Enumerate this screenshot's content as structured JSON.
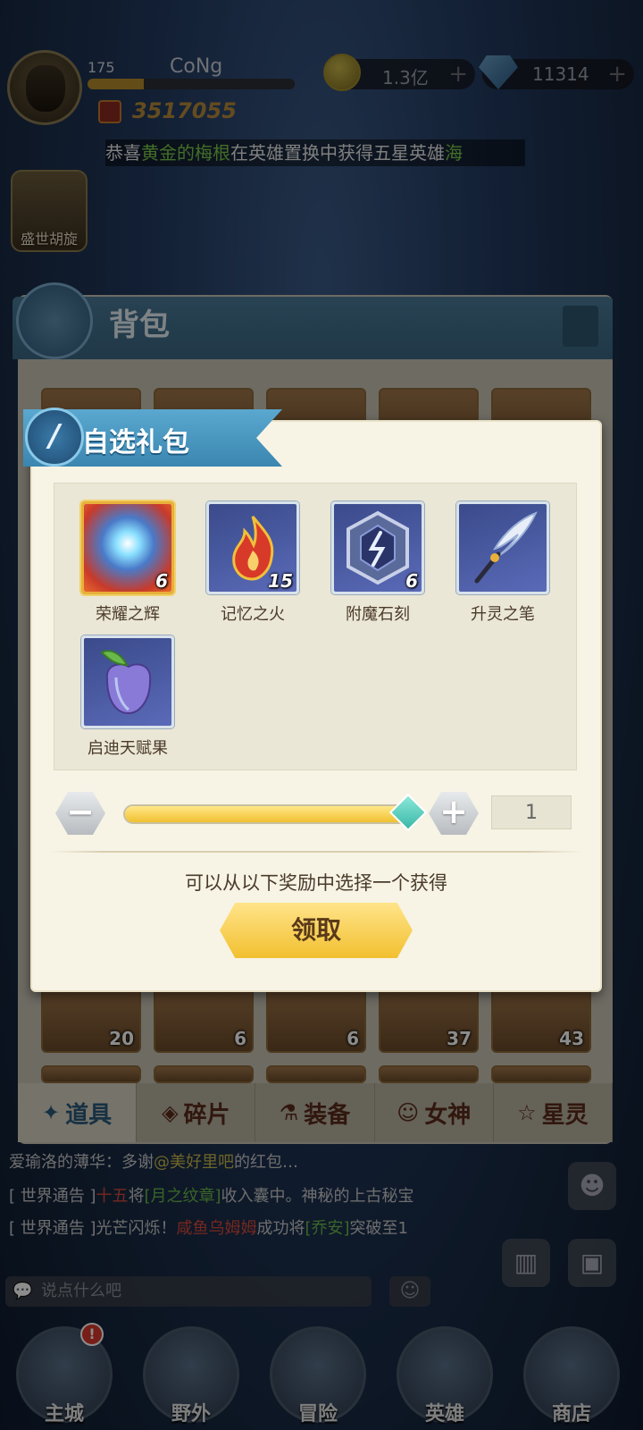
{
  "hud": {
    "level": "175",
    "player_name": "CoNg",
    "exp_fraction": 0.27,
    "power": "3517055",
    "gold": "1.3亿",
    "gems": "11314",
    "plus": "+"
  },
  "marquee": {
    "prefix": "恭喜",
    "player": "黄金的梅根",
    "middle": "在英雄置换中获得五星英雄",
    "suffix": "海"
  },
  "event": {
    "label": "盛世胡旋"
  },
  "bag": {
    "title": "背包",
    "row_top_counts": [
      "",
      "",
      "",
      "",
      ""
    ],
    "row_bottom_counts": [
      "20",
      "6",
      "6",
      "37",
      "43"
    ],
    "tabs": [
      {
        "label": "道具",
        "icon": "✦"
      },
      {
        "label": "碎片",
        "icon": "◈"
      },
      {
        "label": "装备",
        "icon": "⚗"
      },
      {
        "label": "女神",
        "icon": "☺"
      },
      {
        "label": "星灵",
        "icon": "☆"
      }
    ]
  },
  "dialog": {
    "title": "自选礼包",
    "emblem": "/",
    "items": [
      {
        "name": "荣耀之辉",
        "count": "6"
      },
      {
        "name": "记忆之火",
        "count": "15"
      },
      {
        "name": "附魔石刻",
        "count": "6"
      },
      {
        "name": "升灵之笔",
        "count": ""
      },
      {
        "name": "启迪天赋果",
        "count": ""
      }
    ],
    "quantity": "1",
    "slider_fraction": 1.0,
    "minus": "−",
    "plus": "+",
    "hint": "可以从以下奖励中选择一个获得",
    "claim": "领取"
  },
  "chat": {
    "line1": {
      "user": "爱瑜洛的薄华",
      "text": "：多谢",
      "mention": "@美好里吧",
      "tail": "的红包…"
    },
    "line2": {
      "tag": "[ 世界通告 ]",
      "player": "十五",
      "a": "将",
      "item": "[月之纹章]",
      "b": "收入囊中。神秘的上古秘宝"
    },
    "line3": {
      "tag": "[ 世界通告 ]",
      "a": "光芒闪烁！",
      "player": "咸鱼乌姆姆",
      "b": "成功将",
      "hero": "[乔安]",
      "c": "突破至1"
    },
    "placeholder": "说点什么吧"
  },
  "nav": {
    "items": [
      "主城",
      "野外",
      "冒险",
      "英雄",
      "商店"
    ],
    "badge": "!"
  },
  "colors": {
    "accent_blue": "#3a86b0",
    "gold_button": "#f2c030",
    "highlight_green": "#7ac84a"
  }
}
